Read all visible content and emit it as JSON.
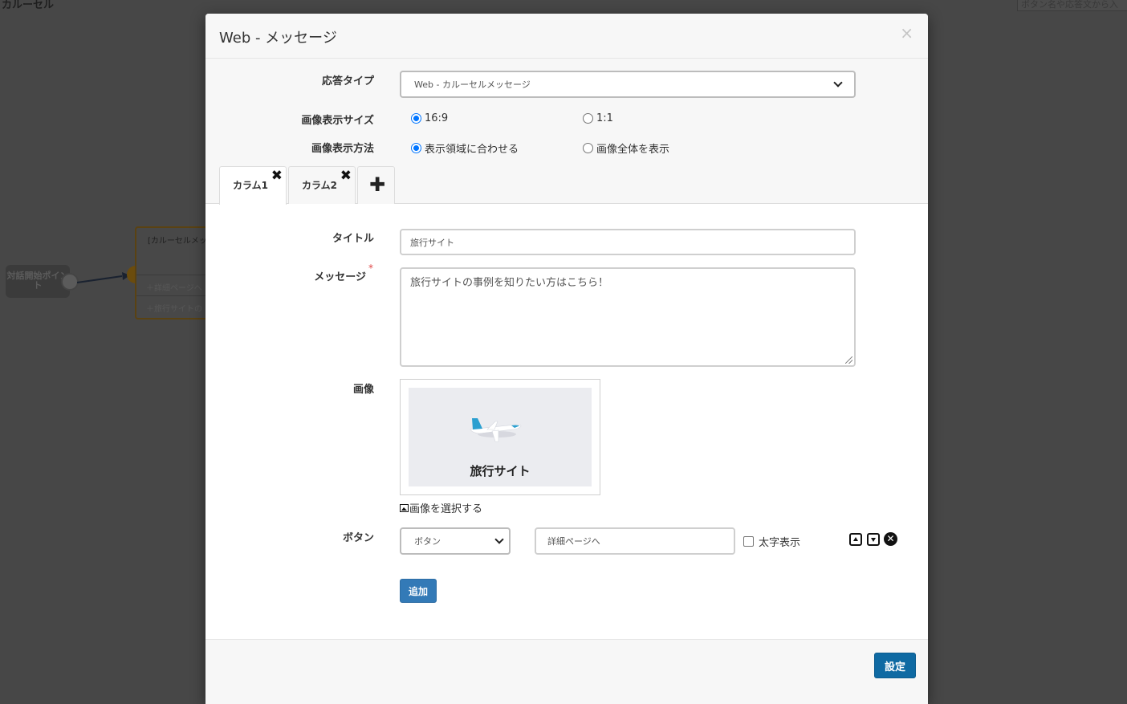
{
  "background": {
    "page_title": "カルーセル",
    "search_placeholder": "ボタン名や応答文から入",
    "start_node_label": "対話開始ポイント",
    "carousel_node": {
      "title": "[カルーセルメッセ",
      "rows": [
        "＋詳細ページへ",
        "＋旅行サイトの"
      ]
    }
  },
  "modal": {
    "title": "Web - メッセージ",
    "close_symbol": "×",
    "response_type": {
      "label": "応答タイプ",
      "selected": "Web - カルーセルメッセージ"
    },
    "image_size": {
      "label": "画像表示サイズ",
      "options": [
        {
          "label": "16:9",
          "checked": true
        },
        {
          "label": "1:1",
          "checked": false
        }
      ]
    },
    "image_display": {
      "label": "画像表示方法",
      "options": [
        {
          "label": "表示領域に合わせる",
          "checked": true
        },
        {
          "label": "画像全体を表示",
          "checked": false
        }
      ]
    },
    "tabs": [
      {
        "label": "カラム1",
        "active": true
      },
      {
        "label": "カラム2",
        "active": false
      }
    ],
    "tab_close_symbol": "✖",
    "tab_add_symbol": "✚",
    "form": {
      "title_label": "タイトル",
      "title_value": "旅行サイト",
      "message_label": "メッセージ",
      "required_mark": "*",
      "message_value": "旅行サイトの事例を知りたい方はこちら！",
      "image_label": "画像",
      "image_caption": "旅行サイト",
      "select_image_link": "画像を選択する",
      "button_label": "ボタン",
      "button_type_selected": "ボタン",
      "button_text_value": "詳細ページへ",
      "bold_label": "太字表示",
      "bold_checked": false,
      "remove_symbol": "✕",
      "add_button": "追加"
    },
    "submit_button": "設定"
  },
  "colors": {
    "primary_button": "#337ab7",
    "radio_checked": "#0075ff",
    "required": "#e04848",
    "overlay": "#474747"
  }
}
